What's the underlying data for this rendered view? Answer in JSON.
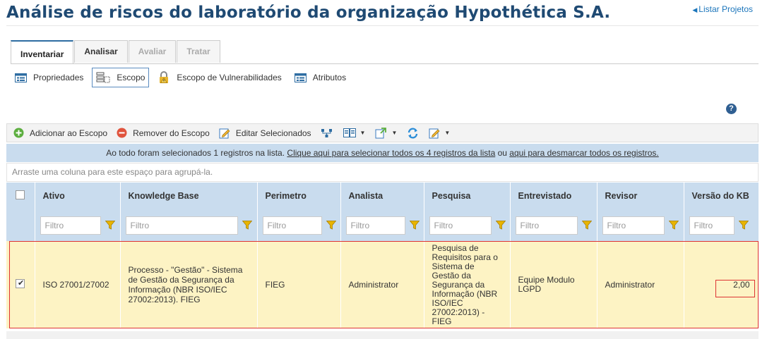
{
  "page": {
    "title": "Análise de riscos do laboratório da organização Hypothética S.A.",
    "back_link": "Listar Projetos"
  },
  "tabs": [
    {
      "label": "Inventariar",
      "state": "active"
    },
    {
      "label": "Analisar",
      "state": "normal"
    },
    {
      "label": "Avaliar",
      "state": "disabled"
    },
    {
      "label": "Tratar",
      "state": "disabled"
    }
  ],
  "subtabs": [
    {
      "label": "Propriedades"
    },
    {
      "label": "Escopo"
    },
    {
      "label": "Escopo de Vulnerabilidades"
    },
    {
      "label": "Atributos"
    }
  ],
  "help": "?",
  "toolbar": {
    "add": "Adicionar ao Escopo",
    "remove": "Remover do Escopo",
    "edit": "Editar Selecionados"
  },
  "selection": {
    "text": "Ao todo foram selecionados 1 registros na lista.",
    "select_all": "Clique aqui para selecionar todos os 4 registros da lista",
    "or": "ou",
    "deselect": "aqui para desmarcar todos os registros."
  },
  "group_hint": "Arraste uma coluna para este espaço para agrupá-la.",
  "grid": {
    "columns": [
      "Ativo",
      "Knowledge Base",
      "Perimetro",
      "Analista",
      "Pesquisa",
      "Entrevistado",
      "Revisor",
      "Versão do KB"
    ],
    "filter_placeholder": "Filtro",
    "rows": [
      {
        "checked": true,
        "ativo": "ISO 27001/27002",
        "knowledge_base": "Processo - \"Gestão\" - Sistema de Gestão da Segurança da Informação (NBR ISO/IEC 27002:2013). FIEG",
        "perimetro": "FIEG",
        "analista": "Administrator",
        "pesquisa": "Pesquisa de Requisitos para o Sistema de Gestão da Segurança da Informação (NBR ISO/IEC 27002:2013) - FIEG",
        "entrevistado": "Equipe Modulo LGPD",
        "revisor": "Administrator",
        "versao": "2,00"
      }
    ]
  },
  "colors": {
    "title": "#1f4a73",
    "header_bg": "#c9dcee",
    "selected_row": "#fdf3c4",
    "highlight": "#dd3333",
    "link": "#1b75bb"
  }
}
